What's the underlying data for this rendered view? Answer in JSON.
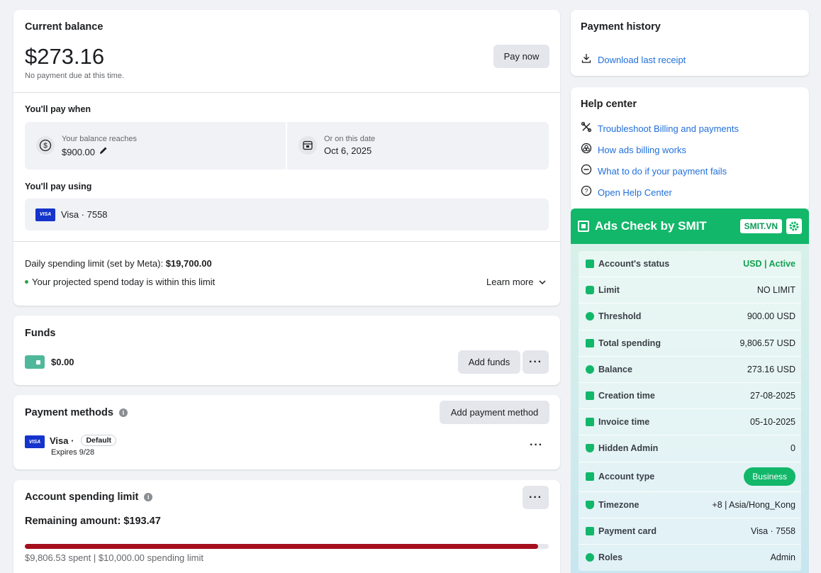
{
  "balance": {
    "title": "Current balance",
    "amount": "$273.16",
    "note": "No payment due at this time.",
    "pay_now": "Pay now",
    "when_title": "You'll pay when",
    "threshold_label": "Your balance reaches",
    "threshold_value": "$900.00",
    "date_label": "Or on this date",
    "date_value": "Oct 6, 2025",
    "using_title": "You'll pay using",
    "card": "Visa · 7558",
    "visa_badge": "VISA",
    "daily_limit_prefix": "Daily spending limit (set by Meta): ",
    "daily_limit_value": "$19,700.00",
    "projected": "Your projected spend today is within this limit",
    "learn_more": "Learn more"
  },
  "funds": {
    "title": "Funds",
    "amount": "$0.00",
    "add_funds": "Add funds",
    "more": "···"
  },
  "payment_methods": {
    "title": "Payment methods",
    "add": "Add payment method",
    "card_name": "Visa · ",
    "default_badge": "Default",
    "expires": "Expires 9/28",
    "visa_badge": "VISA",
    "more": "···"
  },
  "spending_limit": {
    "title": "Account spending limit",
    "remaining": "Remaining amount: $193.47",
    "progress": 0.98,
    "summary": "$9,806.53 spent | $10,000.00 spending limit",
    "more": "···",
    "bar_color": "#a50e1c"
  },
  "history": {
    "title": "Payment history",
    "download": "Download last receipt"
  },
  "help": {
    "title": "Help center",
    "items": [
      {
        "label": "Troubleshoot Billing and payments",
        "icon": "tools-icon"
      },
      {
        "label": "How ads billing works",
        "icon": "cubes-icon"
      },
      {
        "label": "What to do if your payment fails",
        "icon": "minus-circle-icon"
      },
      {
        "label": "Open Help Center",
        "icon": "question-circle-icon"
      }
    ]
  },
  "smit": {
    "title": "Ads Check by SMIT",
    "tag": "SMIT.VN",
    "accent": "#12b76a",
    "rows": [
      {
        "label": "Account's status",
        "value": "USD | Active"
      },
      {
        "label": "Limit",
        "value": "NO LIMIT"
      },
      {
        "label": "Threshold",
        "value": "900.00 USD"
      },
      {
        "label": "Total spending",
        "value": "9,806.57 USD"
      },
      {
        "label": "Balance",
        "value": "273.16 USD"
      },
      {
        "label": "Creation time",
        "value": "27-08-2025"
      },
      {
        "label": "Invoice time",
        "value": "05-10-2025"
      },
      {
        "label": "Hidden Admin",
        "value": "0"
      },
      {
        "label": "Account type",
        "value": "Business"
      },
      {
        "label": "Timezone",
        "value": "+8 | Asia/Hong_Kong"
      },
      {
        "label": "Payment card",
        "value": "Visa · 7558"
      },
      {
        "label": "Roles",
        "value": "Admin"
      }
    ]
  }
}
